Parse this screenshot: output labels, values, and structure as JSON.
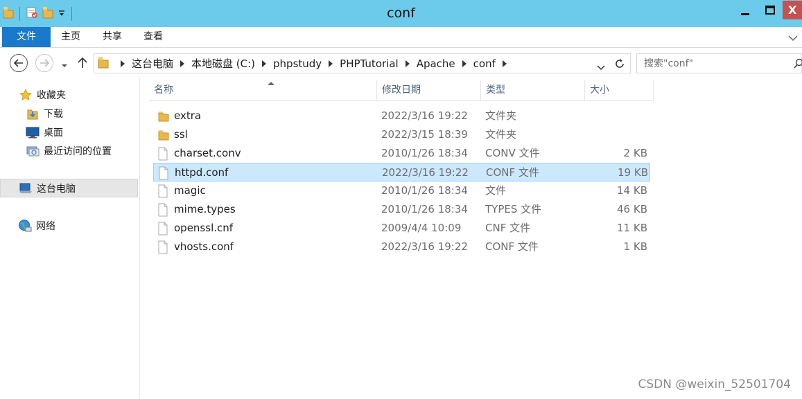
{
  "window": {
    "title": "conf",
    "close_glyph": "X",
    "qat_icons": [
      "folder-icon",
      "properties-icon",
      "new-folder-icon",
      "customize-dropdown-icon"
    ]
  },
  "ribbon": {
    "tabs": [
      "文件",
      "主页",
      "共享",
      "查看"
    ],
    "file_tab_color": "#1979ca"
  },
  "address": {
    "path": [
      "这台电脑",
      "本地磁盘 (C:)",
      "phpstudy",
      "PHPTutorial",
      "Apache",
      "conf"
    ]
  },
  "search": {
    "placeholder": "搜索\"conf\""
  },
  "nav": {
    "favorites": "收藏夹",
    "downloads": "下载",
    "desktop": "桌面",
    "recent": "最近访问的位置",
    "this_pc": "这台电脑",
    "network": "网络"
  },
  "columns": {
    "name": "名称",
    "date": "修改日期",
    "type": "类型",
    "size": "大小"
  },
  "files": [
    {
      "name": "extra",
      "date": "2022/3/16 19:22",
      "type": "文件夹",
      "size": "",
      "kind": "folder"
    },
    {
      "name": "ssl",
      "date": "2022/3/15 18:39",
      "type": "文件夹",
      "size": "",
      "kind": "folder"
    },
    {
      "name": "charset.conv",
      "date": "2010/1/26 18:34",
      "type": "CONV 文件",
      "size": "2 KB",
      "kind": "file"
    },
    {
      "name": "httpd.conf",
      "date": "2022/3/16 19:22",
      "type": "CONF 文件",
      "size": "19 KB",
      "kind": "file",
      "selected": true
    },
    {
      "name": "magic",
      "date": "2010/1/26 18:34",
      "type": "文件",
      "size": "14 KB",
      "kind": "file"
    },
    {
      "name": "mime.types",
      "date": "2010/1/26 18:34",
      "type": "TYPES 文件",
      "size": "46 KB",
      "kind": "file"
    },
    {
      "name": "openssl.cnf",
      "date": "2009/4/4 10:09",
      "type": "CNF 文件",
      "size": "11 KB",
      "kind": "file"
    },
    {
      "name": "vhosts.conf",
      "date": "2022/3/16 19:22",
      "type": "CONF 文件",
      "size": "1 KB",
      "kind": "file"
    }
  ],
  "watermark": "CSDN @weixin_52501704",
  "colors": {
    "titlebar": "#6ccbea",
    "selection": "#cce8ff",
    "selection_border": "#99d1ff",
    "folder": "#e8b84a"
  }
}
